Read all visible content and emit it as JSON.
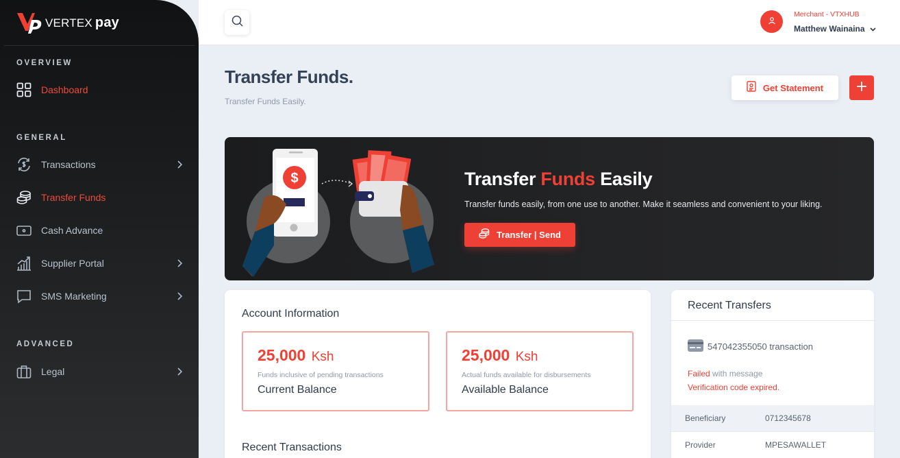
{
  "brand": {
    "name": "VERTEX",
    "suffix": "pay"
  },
  "sidebar": {
    "sections": {
      "overview": "OVERVIEW",
      "general": "GENERAL",
      "advanced": "ADVANCED"
    },
    "items": {
      "dashboard": "Dashboard",
      "transactions": "Transactions",
      "transfer_funds": "Transfer Funds",
      "cash_advance": "Cash Advance",
      "supplier_portal": "Supplier Portal",
      "sms_marketing": "SMS Marketing",
      "legal": "Legal"
    },
    "active_item": "transfer_funds"
  },
  "topbar": {
    "merchant": "Merchant - VTXHUB",
    "user_name": "Matthew Wainaina"
  },
  "page": {
    "title": "Transfer Funds.",
    "subtitle": "Transfer Funds Easily.",
    "statement_button": "Get Statement"
  },
  "banner": {
    "title_part1": "Transfer",
    "title_part2": "Funds",
    "title_part3": "Easily",
    "description": "Transfer funds easily, from one use to another. Make it seamless and convenient to your liking.",
    "button": "Transfer | Send"
  },
  "account": {
    "title": "Account Information",
    "current": {
      "amount": "25,000",
      "currency": "Ksh",
      "note": "Funds inclusive of pending transactions",
      "label": "Current Balance"
    },
    "available": {
      "amount": "25,000",
      "currency": "Ksh",
      "note": "Actual funds available for disbursements",
      "label": "Available Balance"
    },
    "recent_transactions_title": "Recent Transactions"
  },
  "recent_transfers": {
    "title": "Recent Transfers",
    "transaction": "547042355050 transaction",
    "status": "Failed",
    "status_suffix": "with message",
    "message": "Verification code expired.",
    "rows": [
      {
        "key": "Beneficiary",
        "value": "0712345678"
      },
      {
        "key": "Provider",
        "value": "MPESAWALLET"
      }
    ]
  },
  "colors": {
    "accent": "#ee4034",
    "sidebar_bg": "#1c1e20",
    "page_bg": "#eaeef5",
    "text_dark": "#2f3b4c",
    "muted": "#8f99a8"
  },
  "icons": {
    "search": "search-icon",
    "user": "user-icon",
    "dashboard": "grid-icon",
    "transactions": "dollar-exchange-icon",
    "transfer": "coins-stack-icon",
    "cash": "cash-icon",
    "supplier": "bar-chart-icon",
    "sms": "chat-bubble-icon",
    "legal": "briefcase-icon",
    "statement": "document-icon",
    "plus": "plus-icon",
    "card": "credit-card-icon"
  }
}
